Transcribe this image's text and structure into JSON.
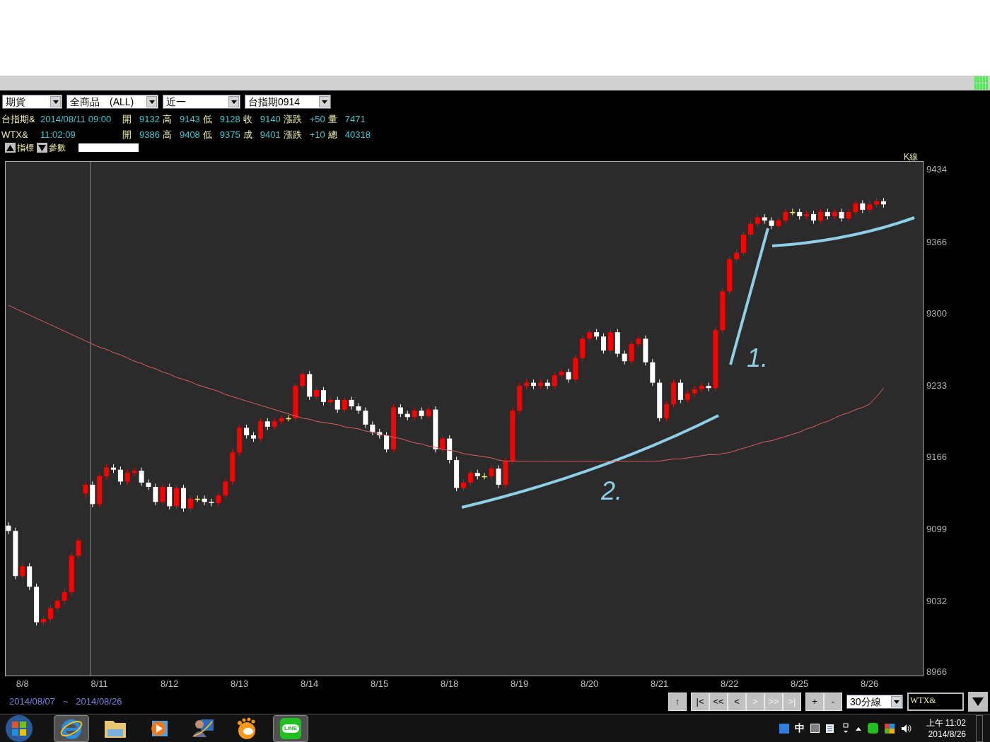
{
  "selects": [
    {
      "value": "期貨"
    },
    {
      "value": "全商品　(ALL)"
    },
    {
      "value": "近一"
    },
    {
      "value": "台指期0914"
    }
  ],
  "quote_rows": [
    {
      "symbol": "台指期&",
      "time": "2014/08/11 09:00",
      "fields": [
        {
          "label": "開",
          "value": "9132"
        },
        {
          "label": "高",
          "value": "9143"
        },
        {
          "label": "低",
          "value": "9128"
        },
        {
          "label": "收",
          "value": "9140"
        },
        {
          "label": "漲跌",
          "value": "+50"
        },
        {
          "label": "量",
          "value": "7471"
        }
      ]
    },
    {
      "symbol": "WTX&",
      "time": "11:02:09",
      "fields": [
        {
          "label": "開",
          "value": "9386"
        },
        {
          "label": "高",
          "value": "9408"
        },
        {
          "label": "低",
          "value": "9375"
        },
        {
          "label": "成",
          "value": "9401"
        },
        {
          "label": "漲跌",
          "value": "+10"
        },
        {
          "label": "總",
          "value": "40318"
        }
      ]
    }
  ],
  "indicator_buttons": [
    {
      "kind": "up",
      "label": "指標"
    },
    {
      "kind": "down",
      "label": "參數"
    }
  ],
  "chart": {
    "label": "K線",
    "chart_data": {
      "type": "candlestick",
      "ylim": [
        8962,
        9441
      ],
      "yticks": [
        9434,
        9366,
        9300,
        9233,
        9166,
        9099,
        9032,
        8966
      ],
      "categories": [
        null,
        null,
        "8/8",
        null,
        null,
        null,
        null,
        null,
        null,
        null,
        null,
        null,
        null,
        "8/11",
        null,
        null,
        null,
        null,
        null,
        null,
        null,
        null,
        null,
        "8/12",
        null,
        null,
        null,
        null,
        null,
        null,
        null,
        null,
        null,
        "8/13",
        null,
        null,
        null,
        null,
        null,
        null,
        null,
        null,
        null,
        "8/14",
        null,
        null,
        null,
        null,
        null,
        null,
        null,
        null,
        null,
        "8/15",
        null,
        null,
        null,
        null,
        null,
        null,
        null,
        null,
        null,
        "8/18",
        null,
        null,
        null,
        null,
        null,
        null,
        null,
        null,
        null,
        "8/19",
        null,
        null,
        null,
        null,
        null,
        null,
        null,
        null,
        null,
        "8/20",
        null,
        null,
        null,
        null,
        null,
        null,
        null,
        null,
        null,
        "8/21",
        null,
        null,
        null,
        null,
        null,
        null,
        null,
        null,
        null,
        "8/22",
        null,
        null,
        null,
        null,
        null,
        null,
        null,
        null,
        null,
        "8/25",
        null,
        null,
        null,
        null,
        null,
        null,
        null,
        null,
        null,
        "8/26",
        null,
        null
      ],
      "ohlc": [
        [
          9102,
          9105,
          9094,
          9097
        ],
        [
          9097,
          9100,
          9052,
          9055
        ],
        [
          9055,
          9067,
          9052,
          9064
        ],
        [
          9064,
          9067,
          9042,
          9045
        ],
        [
          9045,
          9048,
          9009,
          9012
        ],
        [
          9012,
          9018,
          9009,
          9015
        ],
        [
          9015,
          9028,
          9012,
          9025
        ],
        [
          9025,
          9035,
          9022,
          9032
        ],
        [
          9032,
          9043,
          9029,
          9040
        ],
        [
          9040,
          9077,
          9037,
          9074
        ],
        [
          9074,
          9091,
          9071,
          9088
        ],
        [
          9132,
          9143,
          9128,
          9140
        ],
        [
          9140,
          9143,
          9119,
          9122
        ],
        [
          9122,
          9151,
          9119,
          9148
        ],
        [
          9148,
          9159,
          9145,
          9156
        ],
        [
          9156,
          9159,
          9151,
          9154
        ],
        [
          9154,
          9157,
          9140,
          9143
        ],
        [
          9143,
          9154,
          9140,
          9151
        ],
        [
          9151,
          9156,
          9148,
          9153
        ],
        [
          9153,
          9156,
          9139,
          9142
        ],
        [
          9142,
          9145,
          9135,
          9138
        ],
        [
          9138,
          9141,
          9121,
          9124
        ],
        [
          9124,
          9141,
          9121,
          9138
        ],
        [
          9138,
          9141,
          9117,
          9120
        ],
        [
          9120,
          9140,
          9117,
          9137
        ],
        [
          9137,
          9140,
          9115,
          9118
        ],
        [
          9118,
          9130,
          9115,
          9127
        ],
        [
          9127,
          9130,
          9124,
          9127
        ],
        [
          9127,
          9130,
          9121,
          9124
        ],
        [
          9124,
          9127,
          9120,
          9123
        ],
        [
          9123,
          9133,
          9120,
          9130
        ],
        [
          9130,
          9146,
          9127,
          9143
        ],
        [
          9143,
          9173,
          9140,
          9170
        ],
        [
          9170,
          9196,
          9167,
          9193
        ],
        [
          9193,
          9196,
          9183,
          9186
        ],
        [
          9186,
          9189,
          9180,
          9183
        ],
        [
          9183,
          9202,
          9180,
          9199
        ],
        [
          9199,
          9202,
          9191,
          9194
        ],
        [
          9194,
          9202,
          9191,
          9199
        ],
        [
          9199,
          9205,
          9196,
          9202
        ],
        [
          9202,
          9205,
          9199,
          9202
        ],
        [
          9202,
          9235,
          9199,
          9232
        ],
        [
          9232,
          9246,
          9229,
          9243
        ],
        [
          9243,
          9246,
          9219,
          9222
        ],
        [
          9222,
          9231,
          9219,
          9228
        ],
        [
          9228,
          9231,
          9214,
          9217
        ],
        [
          9217,
          9222,
          9214,
          9219
        ],
        [
          9219,
          9222,
          9207,
          9210
        ],
        [
          9210,
          9222,
          9207,
          9219
        ],
        [
          9219,
          9222,
          9210,
          9213
        ],
        [
          9213,
          9216,
          9206,
          9209
        ],
        [
          9209,
          9212,
          9193,
          9196
        ],
        [
          9196,
          9199,
          9186,
          9189
        ],
        [
          9189,
          9192,
          9183,
          9186
        ],
        [
          9186,
          9189,
          9170,
          9173
        ],
        [
          9173,
          9215,
          9170,
          9212
        ],
        [
          9212,
          9215,
          9203,
          9206
        ],
        [
          9206,
          9209,
          9200,
          9203
        ],
        [
          9203,
          9212,
          9200,
          9209
        ],
        [
          9209,
          9212,
          9201,
          9204
        ],
        [
          9204,
          9213,
          9201,
          9210
        ],
        [
          9210,
          9213,
          9170,
          9173
        ],
        [
          9173,
          9186,
          9170,
          9183
        ],
        [
          9183,
          9186,
          9160,
          9163
        ],
        [
          9163,
          9166,
          9134,
          9137
        ],
        [
          9137,
          9145,
          9134,
          9142
        ],
        [
          9142,
          9154,
          9139,
          9151
        ],
        [
          9151,
          9154,
          9145,
          9148
        ],
        [
          9148,
          9151,
          9145,
          9148
        ],
        [
          9148,
          9158,
          9145,
          9155
        ],
        [
          9155,
          9158,
          9137,
          9140
        ],
        [
          9140,
          9165,
          9137,
          9162
        ],
        [
          9162,
          9212,
          9159,
          9209
        ],
        [
          9209,
          9235,
          9206,
          9232
        ],
        [
          9232,
          9238,
          9229,
          9235
        ],
        [
          9235,
          9238,
          9229,
          9232
        ],
        [
          9232,
          9238,
          9229,
          9235
        ],
        [
          9235,
          9238,
          9229,
          9232
        ],
        [
          9232,
          9245,
          9229,
          9242
        ],
        [
          9242,
          9248,
          9239,
          9245
        ],
        [
          9245,
          9248,
          9235,
          9238
        ],
        [
          9238,
          9261,
          9235,
          9258
        ],
        [
          9258,
          9279,
          9255,
          9276
        ],
        [
          9276,
          9285,
          9273,
          9282
        ],
        [
          9282,
          9285,
          9275,
          9278
        ],
        [
          9278,
          9281,
          9262,
          9265
        ],
        [
          9265,
          9285,
          9262,
          9282
        ],
        [
          9282,
          9285,
          9259,
          9262
        ],
        [
          9262,
          9265,
          9252,
          9255
        ],
        [
          9255,
          9274,
          9252,
          9271
        ],
        [
          9271,
          9279,
          9268,
          9276
        ],
        [
          9276,
          9279,
          9251,
          9254
        ],
        [
          9254,
          9257,
          9232,
          9235
        ],
        [
          9235,
          9238,
          9199,
          9202
        ],
        [
          9202,
          9218,
          9199,
          9215
        ],
        [
          9215,
          9238,
          9212,
          9235
        ],
        [
          9235,
          9238,
          9216,
          9219
        ],
        [
          9219,
          9228,
          9216,
          9225
        ],
        [
          9225,
          9232,
          9222,
          9229
        ],
        [
          9229,
          9235,
          9226,
          9232
        ],
        [
          9232,
          9235,
          9227,
          9230
        ],
        [
          9230,
          9287,
          9227,
          9284
        ],
        [
          9284,
          9323,
          9281,
          9320
        ],
        [
          9320,
          9353,
          9317,
          9350
        ],
        [
          9350,
          9359,
          9347,
          9356
        ],
        [
          9356,
          9376,
          9353,
          9373
        ],
        [
          9373,
          9386,
          9370,
          9383
        ],
        [
          9383,
          9392,
          9380,
          9389
        ],
        [
          9389,
          9392,
          9383,
          9386
        ],
        [
          9386,
          9389,
          9378,
          9381
        ],
        [
          9381,
          9389,
          9378,
          9386
        ],
        [
          9386,
          9397,
          9383,
          9394
        ],
        [
          9394,
          9397,
          9391,
          9394
        ],
        [
          9394,
          9397,
          9387,
          9390
        ],
        [
          9390,
          9395,
          9387,
          9392
        ],
        [
          9392,
          9395,
          9383,
          9386
        ],
        [
          9386,
          9397,
          9383,
          9394
        ],
        [
          9394,
          9397,
          9387,
          9390
        ],
        [
          9390,
          9397,
          9387,
          9394
        ],
        [
          9394,
          9397,
          9385,
          9388
        ],
        [
          9388,
          9397,
          9385,
          9394
        ],
        [
          9394,
          9405,
          9391,
          9402
        ],
        [
          9402,
          9405,
          9393,
          9396
        ],
        [
          9396,
          9404,
          9393,
          9401
        ],
        [
          9401,
          9407,
          9398,
          9404
        ],
        [
          9404,
          9407,
          9398,
          9401
        ]
      ],
      "annotations": [
        {
          "text": "1."
        },
        {
          "text": "2."
        }
      ]
    },
    "moving_average": {
      "chart_data": {
        "type": "line",
        "ylim": [
          8962,
          9441
        ],
        "series": [
          {
            "color": "#e06060",
            "values": [
              9307,
              9304,
              9301,
              9298,
              9295,
              9292,
              9289,
              9286,
              9283,
              9280,
              9277,
              9274,
              9271,
              9268,
              9266,
              9263,
              9261,
              9258,
              9255,
              9253,
              9250,
              9248,
              9245,
              9243,
              9240,
              9238,
              9236,
              9233,
              9231,
              9229,
              9227,
              9224,
              9222,
              9220,
              9218,
              9216,
              9214,
              9212,
              9210,
              9208,
              9206,
              9204,
              9202,
              9201,
              9199,
              9198,
              9197,
              9196,
              9194,
              9193,
              9192,
              9190,
              9189,
              9187,
              9186,
              9184,
              9183,
              9181,
              9179,
              9178,
              9176,
              9175,
              9173,
              9172,
              9171,
              9169,
              9168,
              9167,
              9166,
              9165,
              9163,
              9162,
              9162,
              9162,
              9162,
              9162,
              9162,
              9162,
              9162,
              9162,
              9162,
              9162,
              9162,
              9162,
              9162,
              9162,
              9162,
              9162,
              9162,
              9162,
              9162,
              9162,
              9162,
              9162,
              9163,
              9164,
              9164,
              9165,
              9166,
              9167,
              9168,
              9168,
              9169,
              9170,
              9172,
              9174,
              9176,
              9178,
              9180,
              9181,
              9183,
              9185,
              9187,
              9189,
              9192,
              9194,
              9197,
              9199,
              9202,
              9205,
              9207,
              9210,
              9212,
              9215,
              9222,
              9230
            ]
          }
        ]
      }
    }
  },
  "date_range": {
    "start": "2014/08/07",
    "separator": "~",
    "end": "2014/08/26"
  },
  "nav_buttons": [
    {
      "label": "↑",
      "disabled": false
    },
    {
      "label": "|<",
      "disabled": false
    },
    {
      "label": "<<",
      "disabled": false
    },
    {
      "label": "<",
      "disabled": false
    },
    {
      "label": ">",
      "disabled": true
    },
    {
      "label": ">>",
      "disabled": true
    },
    {
      "label": ">|",
      "disabled": true
    },
    {
      "label": "+",
      "disabled": false
    },
    {
      "label": "-",
      "disabled": false
    }
  ],
  "period_select": {
    "value": "30分線"
  },
  "symbol_field": {
    "value": "WTX&"
  },
  "taskbar": {
    "apps": [
      {
        "kind": "ie",
        "running": true
      },
      {
        "kind": "folder",
        "running": false
      },
      {
        "kind": "media",
        "running": false
      },
      {
        "kind": "user",
        "running": false
      },
      {
        "kind": "orange",
        "running": false
      },
      {
        "kind": "line",
        "running": true,
        "label": "LINE"
      }
    ],
    "ime": "中",
    "time": "上午 11:02",
    "date": "2014/8/26"
  }
}
